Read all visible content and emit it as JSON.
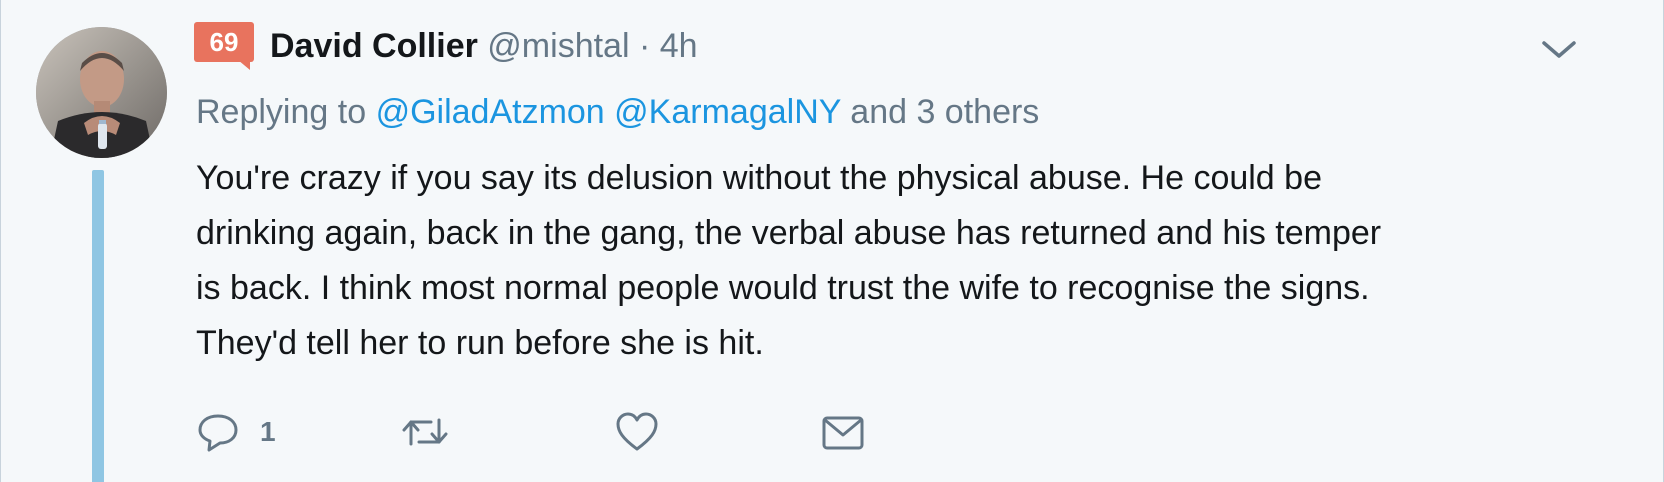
{
  "badge": {
    "count": "69"
  },
  "author": {
    "name": "David Collier",
    "handle": "@mishtal",
    "separator": "·",
    "time": "4h"
  },
  "reply_to": {
    "prefix": "Replying to",
    "mention_1": "@GiladAtzmon",
    "mention_2": "@KarmagalNY",
    "suffix": "and 3 others"
  },
  "tweet": {
    "lines": [
      "You're crazy if you say its delusion without the physical abuse. He could be",
      "drinking again, back in the gang, the verbal abuse has returned and his temper",
      "is back. I think most normal people would trust the wife to recognise the signs.",
      "They'd tell her to run before she is hit."
    ]
  },
  "actions": {
    "reply_count": "1",
    "icons": [
      "reply-icon",
      "retweet-icon",
      "like-icon",
      "direct-message-icon"
    ]
  },
  "colors": {
    "background": "#f5f8fa",
    "text": "#14171a",
    "muted": "#657786",
    "link": "#1b95e0",
    "badge": "#e8735e",
    "thread_line": "#8fc6e3"
  }
}
